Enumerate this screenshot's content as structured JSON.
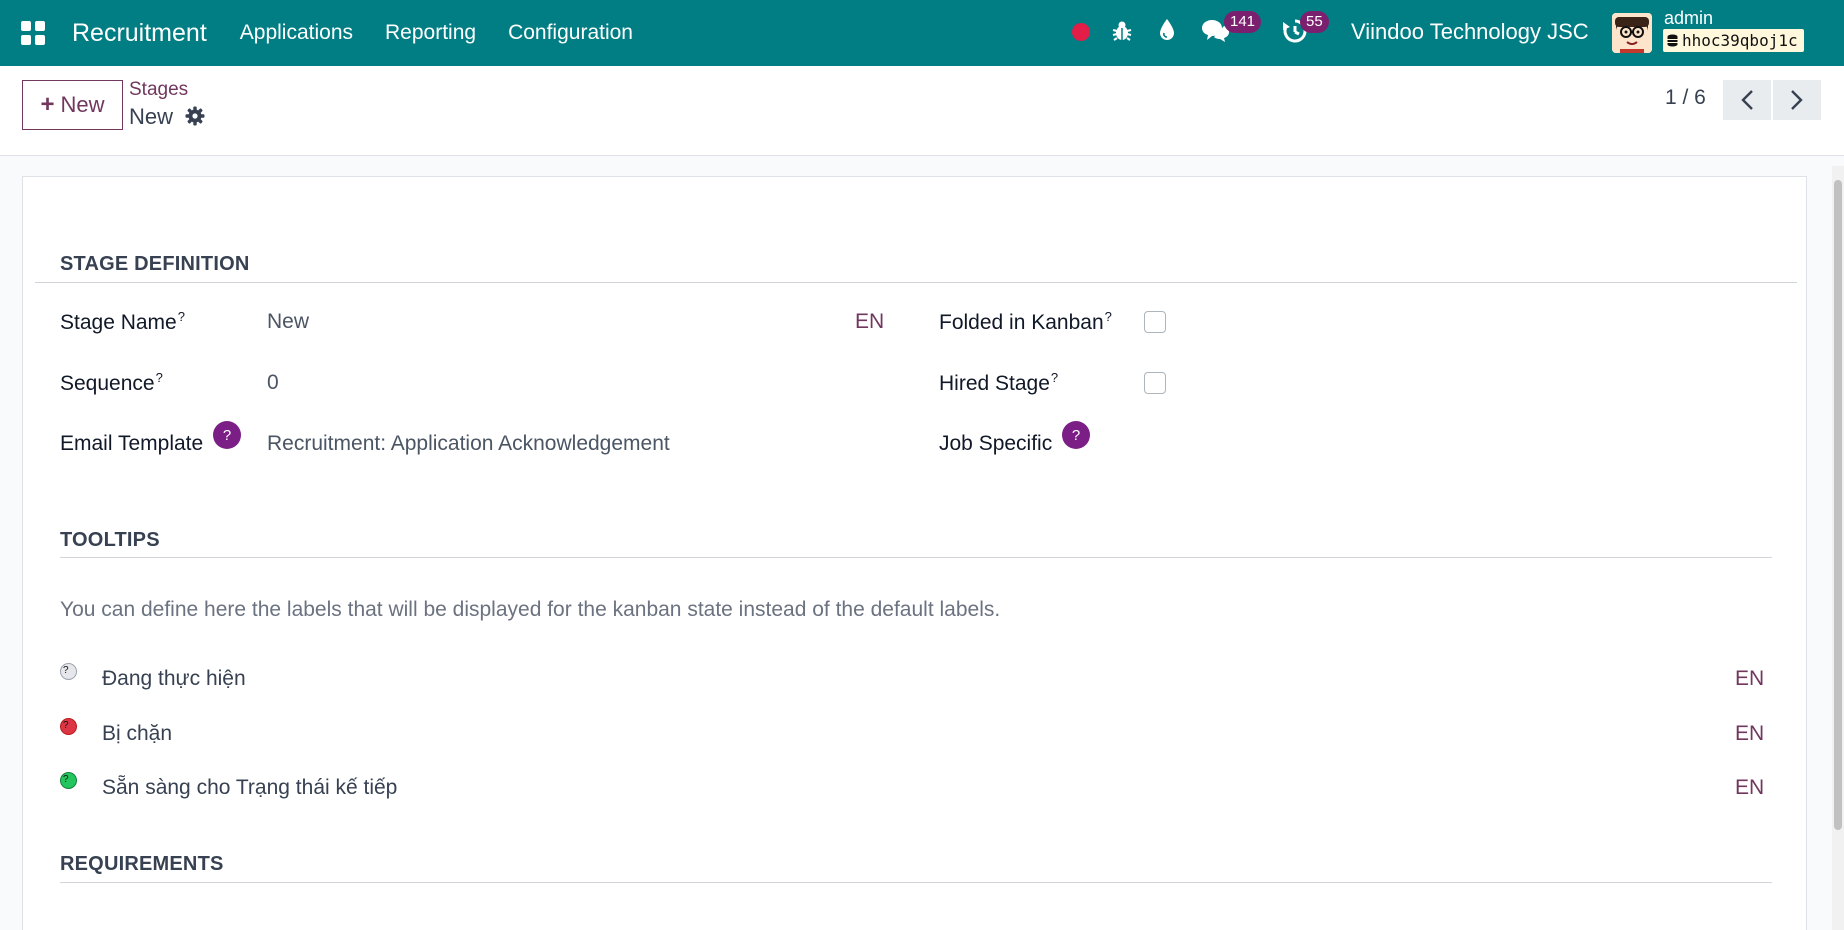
{
  "navbar": {
    "app_name": "Recruitment",
    "menu": [
      "Applications",
      "Reporting",
      "Configuration"
    ],
    "messages_badge": "141",
    "activities_badge": "55",
    "company": "Viindoo Technology JSC",
    "user_name": "admin",
    "database": "hhoc39qboj1c",
    "icons": [
      "apps-grid-icon",
      "record-dot-icon",
      "bug-icon",
      "droplet-icon",
      "chat-icon",
      "clock-icon"
    ]
  },
  "control_panel": {
    "new_label": "New",
    "breadcrumb": "Stages",
    "record_title": "New",
    "pager": "1 / 6"
  },
  "form": {
    "stage_definition": {
      "title": "STAGE DEFINITION",
      "stage_name_label": "Stage Name",
      "stage_name_value": "New",
      "sequence_label": "Sequence",
      "sequence_value": "0",
      "email_template_label": "Email Template",
      "email_template_value": "Recruitment: Application Acknowledgement",
      "folded_label": "Folded in Kanban",
      "hired_label": "Hired Stage",
      "job_specific_label": "Job Specific",
      "lang": "EN",
      "folded_checked": false,
      "hired_checked": false
    },
    "tooltips": {
      "title": "TOOLTIPS",
      "hint": "You can define here the labels that will be displayed for the kanban state instead of the default labels.",
      "states": [
        {
          "label": "Đang thực hiện",
          "color": "#e5e7eb",
          "lang": "EN"
        },
        {
          "label": "Bị chặn",
          "color": "#dc3545",
          "lang": "EN"
        },
        {
          "label": "Sẵn sàng cho Trạng thái kế tiếp",
          "color": "#22c55e",
          "lang": "EN"
        }
      ]
    },
    "requirements": {
      "title": "REQUIREMENTS"
    }
  },
  "help_mark": "?",
  "theme": {
    "navbar": "#017e84",
    "primary": "#71375e",
    "badge": "#7b1f6f"
  }
}
